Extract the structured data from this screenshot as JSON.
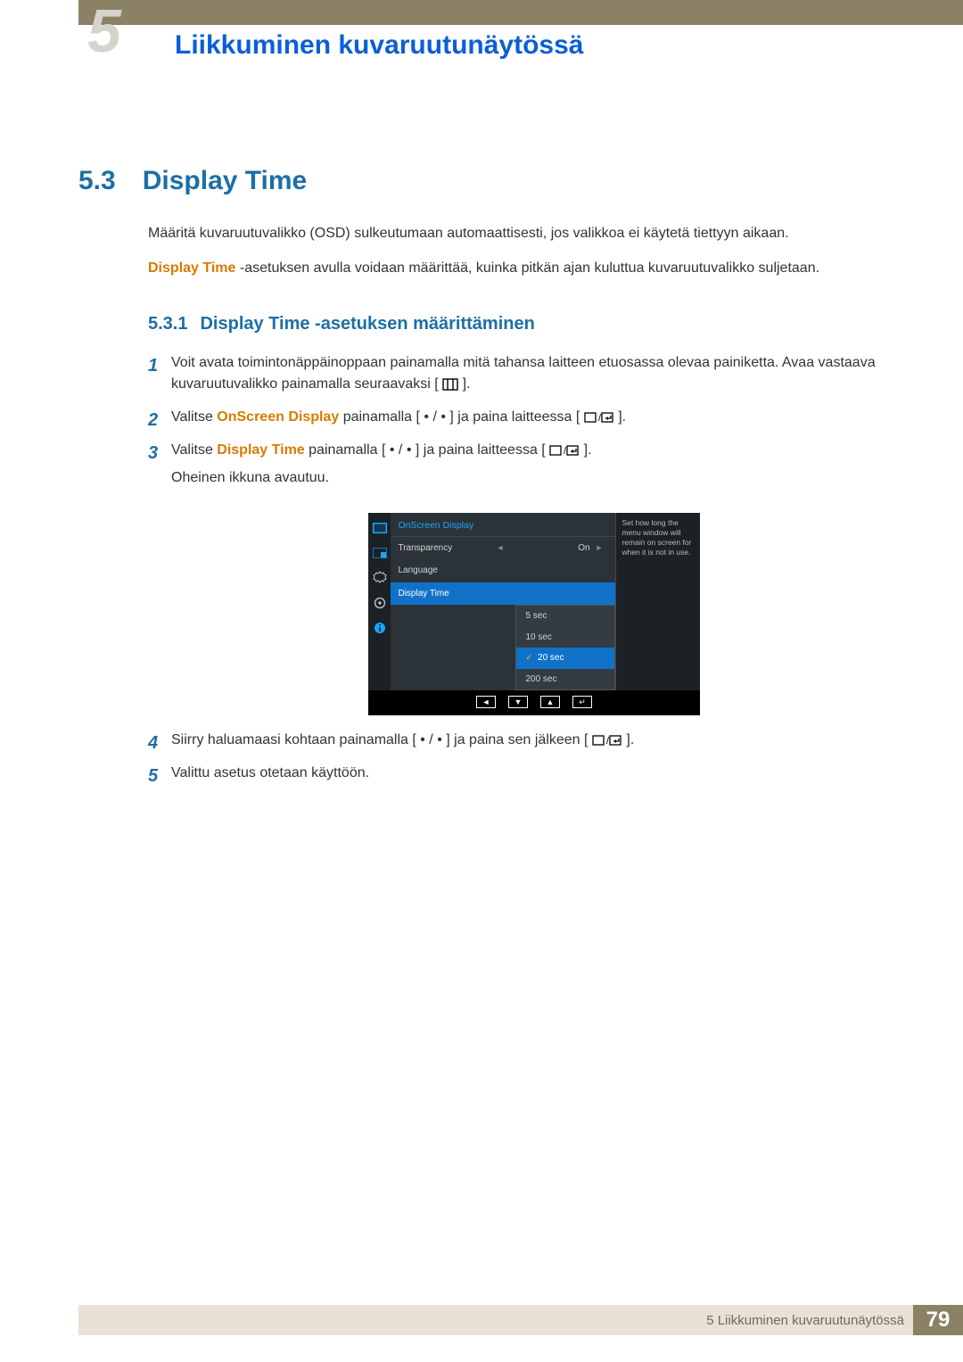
{
  "chapter": {
    "number": "5",
    "title": "Liikkuminen kuvaruutunäytössä"
  },
  "section": {
    "number": "5.3",
    "title": "Display Time"
  },
  "intro": {
    "p1": "Määritä kuvaruutuvalikko (OSD) sulkeutumaan automaattisesti, jos valikkoa ei käytetä tiettyyn aikaan.",
    "p2a": "Display Time",
    "p2b": " -asetuksen avulla voidaan määrittää, kuinka pitkän ajan kuluttua kuvaruutuvalikko suljetaan."
  },
  "subsection": {
    "number": "5.3.1",
    "title": "Display Time -asetuksen määrittäminen"
  },
  "steps": {
    "s1a": "Voit avata toimintonäppäinoppaan painamalla mitä tahansa laitteen etuosassa olevaa painiketta. Avaa vastaava kuvaruutuvalikko painamalla seuraavaksi [",
    "s1b": "].",
    "s2a": "Valitse ",
    "s2name": "OnScreen Display",
    "s2b": " painamalla [",
    "s2c": "] ja paina laitteessa [",
    "s2d": "].",
    "s3a": "Valitse ",
    "s3name": "Display Time",
    "s3b": " painamalla [",
    "s3c": "] ja paina laitteessa [",
    "s3d": "].",
    "s3sub": "Oheinen ikkuna avautuu.",
    "s4a": "Siirry haluamaasi kohtaan painamalla [",
    "s4b": "] ja paina sen jälkeen [",
    "s4c": "].",
    "s5": "Valittu asetus otetaan käyttöön.",
    "dot_slash_dot": " • / • "
  },
  "osd": {
    "header": "OnScreen Display",
    "rows": {
      "transparency": {
        "label": "Transparency",
        "value": "On"
      },
      "language": {
        "label": "Language"
      },
      "display_time": {
        "label": "Display Time"
      }
    },
    "options": [
      "5 sec",
      "10 sec",
      "20 sec",
      "200 sec"
    ],
    "selected_option": "20 sec",
    "help": "Set how long the menu window will remain on screen for when it is not in use.",
    "nav": [
      "◄",
      "▼",
      "▲",
      "↵"
    ]
  },
  "footer": {
    "text": "5 Liikkuminen kuvaruutunäytössä",
    "page": "79"
  },
  "chart_data": null
}
